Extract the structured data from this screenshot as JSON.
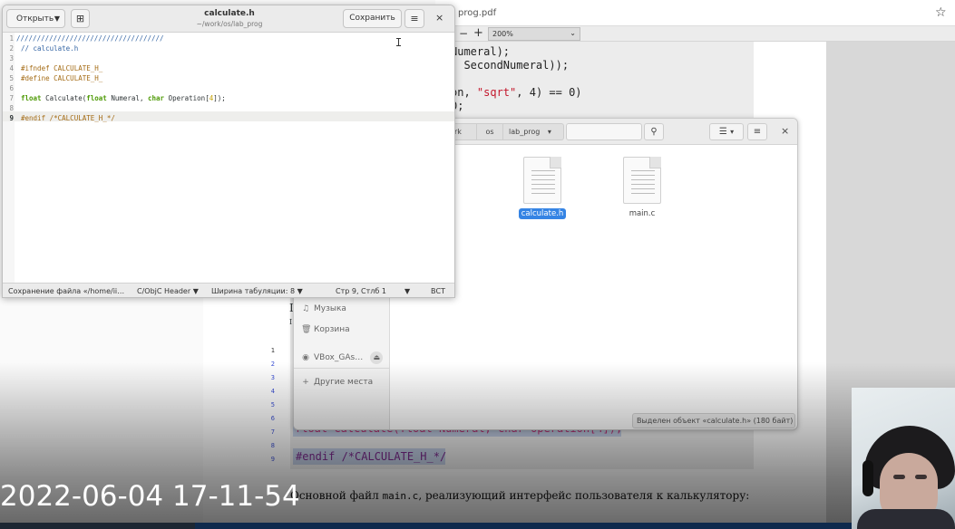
{
  "pdf": {
    "url_suffix": "prog.pdf",
    "zoom": "200%",
    "code_lines": [
      {
        "text": "Numeral);"
      },
      {
        "text": "  SecondNumeral));"
      },
      {
        "pre": "on, ",
        "str": "\"sqrt\"",
        "post": ", 4) == 0)"
      },
      {
        "text": "0;"
      }
    ],
    "line_numbers": [
      "1",
      "2",
      "3",
      "4",
      "5",
      "6",
      "7",
      "8",
      "9"
    ],
    "listing_line7": "float Calculate(float Numeral, char Operation[4]);",
    "listing_line9": "#endif /*CALCULATE_H_*/",
    "body_text_pre": "Основной файл ",
    "body_text_code": "main.c",
    "body_text_post": ", реализующий интерфейс пользователя к калькулятору:"
  },
  "overlay": {
    "timestamp": "2022-06-04 17-11-54"
  },
  "file_manager": {
    "breadcrumbs": [
      "rk",
      "os",
      "lab_prog"
    ],
    "sidebar": [
      {
        "icon": "♫",
        "label": "Музыка"
      },
      {
        "icon": "🗑",
        "label": "Корзина"
      },
      {
        "icon": "◉",
        "label": "VBox_GAs…"
      },
      {
        "icon": "+",
        "label": "Другие места"
      }
    ],
    "files": [
      {
        "name": ".c",
        "selected": false
      },
      {
        "name": "calculate.h",
        "selected": true
      },
      {
        "name": "main.c",
        "selected": false
      }
    ],
    "status": "Выделен объект «calculate.h» (180 байт)"
  },
  "editor": {
    "open_label": "Открыть",
    "title": "calculate.h",
    "path": "~/work/os/lab_prog",
    "save_label": "Сохранить",
    "lines": [
      {
        "n": "1",
        "text": "////////////////////////////////////"
      },
      {
        "n": "2",
        "text": "// calculate.h"
      },
      {
        "n": "3",
        "text": ""
      },
      {
        "n": "4",
        "text": "#ifndef CALCULATE_H_"
      },
      {
        "n": "5",
        "text": "#define CALCULATE_H_"
      },
      {
        "n": "6",
        "text": ""
      },
      {
        "n": "7",
        "text": "float Calculate(float Numeral, char Operation[4]);"
      },
      {
        "n": "8",
        "text": ""
      },
      {
        "n": "9",
        "text": "#endif /*CALCULATE_H_*/"
      }
    ],
    "status": {
      "message": "Сохранение файла «/home/ii…",
      "language": "C/ObjC Header",
      "tab_width": "Ширина табуляции: 8",
      "position": "Стр 9, Стлб 1",
      "insert_mode": "ВСТ"
    }
  }
}
